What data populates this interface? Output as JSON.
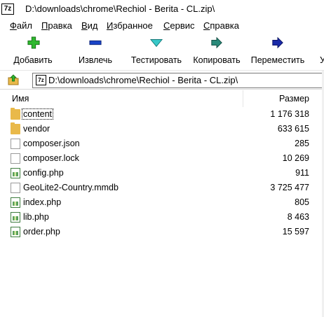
{
  "window": {
    "app_icon_text": "7z",
    "title": "D:\\downloads\\chrome\\Rechiol - Berita - CL.zip\\"
  },
  "menu": [
    {
      "first": "Ф",
      "rest": "айл"
    },
    {
      "first": "П",
      "rest": "равка"
    },
    {
      "first": "В",
      "rest": "ид"
    },
    {
      "first": "И",
      "rest": "збранное"
    },
    {
      "first": "С",
      "rest": "ервис"
    },
    {
      "first": "С",
      "rest": "правка"
    }
  ],
  "toolbar": {
    "add_label": "Добавить",
    "extract_label": "Извлечь",
    "test_label": "Тестировать",
    "copy_label": "Копировать",
    "move_label": "Переместить",
    "delete_label": "У"
  },
  "address": {
    "path": "D:\\downloads\\chrome\\Rechiol - Berita - CL.zip\\"
  },
  "columns": {
    "name": "Имя",
    "size": "Размер"
  },
  "files": [
    {
      "name": "content",
      "size": "1 176 318",
      "icon": "folder-icon"
    },
    {
      "name": "vendor",
      "size": "633 615",
      "icon": "folder-icon"
    },
    {
      "name": "composer.json",
      "size": "285",
      "icon": "file-icon"
    },
    {
      "name": "composer.lock",
      "size": "10 269",
      "icon": "file-icon"
    },
    {
      "name": "config.php",
      "size": "911",
      "icon": "php-file-icon"
    },
    {
      "name": "GeoLite2-Country.mmdb",
      "size": "3 725 477",
      "icon": "file-icon"
    },
    {
      "name": "index.php",
      "size": "805",
      "icon": "php-file-icon"
    },
    {
      "name": "lib.php",
      "size": "8 463",
      "icon": "php-file-icon"
    },
    {
      "name": "order.php",
      "size": "15 597",
      "icon": "php-file-icon"
    }
  ]
}
